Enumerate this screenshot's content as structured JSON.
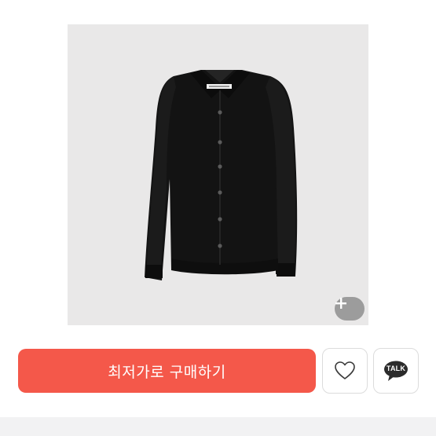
{
  "product": {
    "image_icon": "black-knit-collar-cardigan",
    "label_icon": "garment-neck-label",
    "background_color": "#e9e8e8"
  },
  "zoom": {
    "icon": "plus-icon"
  },
  "actions": {
    "buy_label": "최저가로 구매하기",
    "buy_color": "#f4584a",
    "wish_icon": "heart-outline-icon",
    "talk_label": "TALK",
    "talk_icon": "speech-bubble-icon"
  }
}
